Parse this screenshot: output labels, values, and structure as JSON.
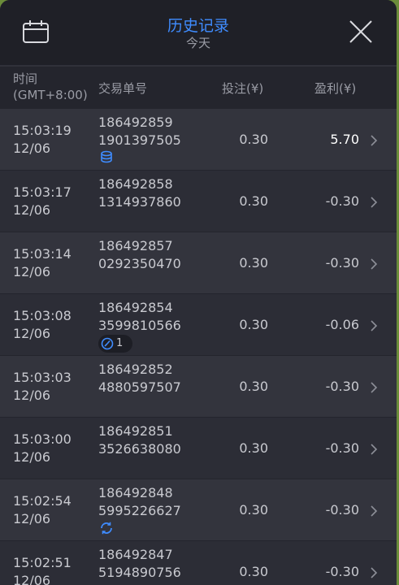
{
  "header": {
    "title": "历史记录",
    "subtitle": "今天"
  },
  "columns": {
    "time_line1": "时间",
    "time_line2": "(GMT+8:00)",
    "order": "交易单号",
    "bet": "投注(¥)",
    "profit": "盈利(¥)"
  },
  "rows": [
    {
      "time": "15:03:19",
      "date": "12/06",
      "order1": "186492859",
      "order2": "1901397505",
      "bet": "0.30",
      "profit": "5.70",
      "badge": "coins-icon"
    },
    {
      "time": "15:03:17",
      "date": "12/06",
      "order1": "186492858",
      "order2": "1314937860",
      "bet": "0.30",
      "profit": "-0.30",
      "badge": ""
    },
    {
      "time": "15:03:14",
      "date": "12/06",
      "order1": "186492857",
      "order2": "0292350470",
      "bet": "0.30",
      "profit": "-0.30",
      "badge": ""
    },
    {
      "time": "15:03:08",
      "date": "12/06",
      "order1": "186492854",
      "order2": "3599810566",
      "bet": "0.30",
      "profit": "-0.06",
      "badge": "gauge-icon",
      "badge_count": "1"
    },
    {
      "time": "15:03:03",
      "date": "12/06",
      "order1": "186492852",
      "order2": "4880597507",
      "bet": "0.30",
      "profit": "-0.30",
      "badge": ""
    },
    {
      "time": "15:03:00",
      "date": "12/06",
      "order1": "186492851",
      "order2": "3526638080",
      "bet": "0.30",
      "profit": "-0.30",
      "badge": ""
    },
    {
      "time": "15:02:54",
      "date": "12/06",
      "order1": "186492848",
      "order2": "5995226627",
      "bet": "0.30",
      "profit": "-0.30",
      "badge": "refresh-icon"
    },
    {
      "time": "15:02:51",
      "date": "12/06",
      "order1": "186492847",
      "order2": "5194890756",
      "bet": "0.30",
      "profit": "-0.30",
      "badge": ""
    }
  ],
  "colors": {
    "accent": "#3f8cff",
    "panel": "#2a2b33",
    "header": "#1f2027"
  }
}
